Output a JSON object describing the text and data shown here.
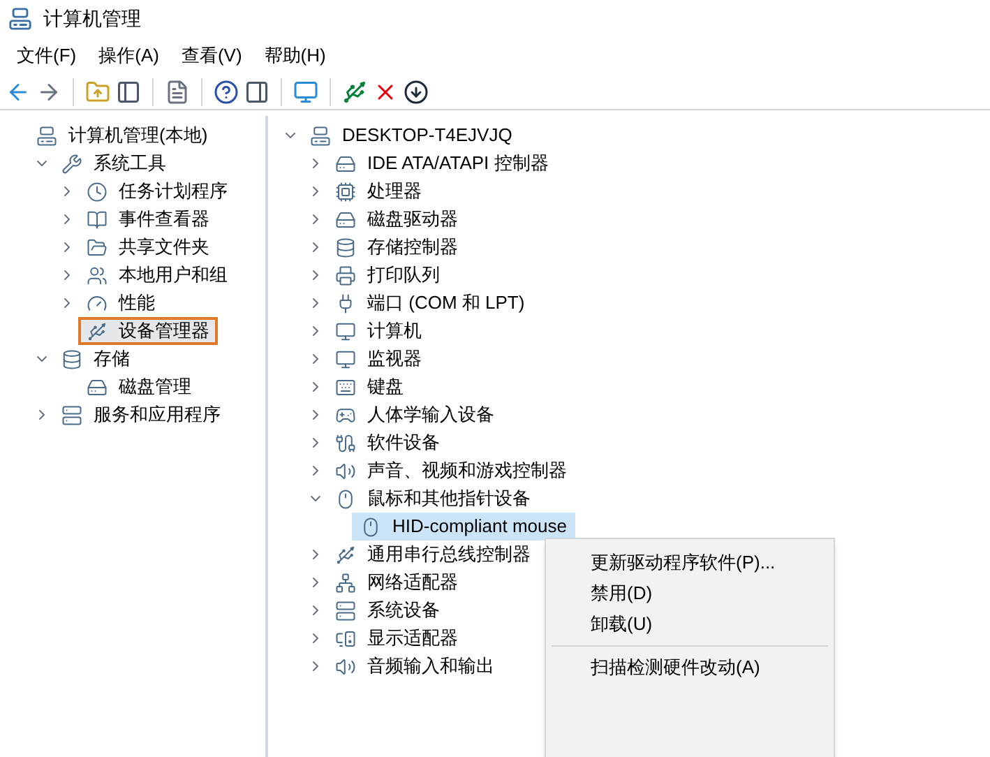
{
  "window": {
    "title": "计算机管理"
  },
  "menu": [
    "文件(F)",
    "操作(A)",
    "查看(V)",
    "帮助(H)"
  ],
  "left_tree": [
    {
      "label": "计算机管理(本地)",
      "selected": false,
      "children": [
        {
          "label": "系统工具",
          "expanded": true,
          "selected": false,
          "children": [
            {
              "label": "任务计划程序",
              "expanded": false,
              "selected": false
            },
            {
              "label": "事件查看器",
              "expanded": false,
              "selected": false
            },
            {
              "label": "共享文件夹",
              "expanded": false,
              "selected": false
            },
            {
              "label": "本地用户和组",
              "expanded": false,
              "selected": false
            },
            {
              "label": "性能",
              "expanded": false,
              "selected": false
            },
            {
              "label": "设备管理器",
              "selected": true
            }
          ]
        },
        {
          "label": "存储",
          "expanded": true,
          "selected": false,
          "children": [
            {
              "label": "磁盘管理",
              "selected": false
            }
          ]
        },
        {
          "label": "服务和应用程序",
          "expanded": false,
          "selected": false
        }
      ]
    }
  ],
  "device_tree": [
    {
      "label": "DESKTOP-T4EJVJQ",
      "expanded": true,
      "selected": false,
      "children": [
        {
          "label": "IDE ATA/ATAPI 控制器",
          "expanded": false,
          "selected": false
        },
        {
          "label": "处理器",
          "expanded": false,
          "selected": false
        },
        {
          "label": "磁盘驱动器",
          "expanded": false,
          "selected": false
        },
        {
          "label": "存储控制器",
          "expanded": false,
          "selected": false
        },
        {
          "label": "打印队列",
          "expanded": false,
          "selected": false
        },
        {
          "label": "端口 (COM 和 LPT)",
          "expanded": false,
          "selected": false
        },
        {
          "label": "计算机",
          "expanded": false,
          "selected": false
        },
        {
          "label": "监视器",
          "expanded": false,
          "selected": false
        },
        {
          "label": "键盘",
          "expanded": false,
          "selected": false
        },
        {
          "label": "人体学输入设备",
          "expanded": false,
          "selected": false
        },
        {
          "label": "软件设备",
          "expanded": false,
          "selected": false
        },
        {
          "label": "声音、视频和游戏控制器",
          "expanded": false,
          "selected": false
        },
        {
          "label": "鼠标和其他指针设备",
          "expanded": true,
          "selected": false,
          "children": [
            {
              "label": "HID-compliant mouse",
              "selected": true
            }
          ]
        },
        {
          "label": "通用串行总线控制器",
          "expanded": false,
          "selected": false
        },
        {
          "label": "网络适配器",
          "expanded": false,
          "selected": false
        },
        {
          "label": "系统设备",
          "expanded": false,
          "selected": false
        },
        {
          "label": "显示适配器",
          "expanded": false,
          "selected": false
        },
        {
          "label": "音频输入和输出",
          "expanded": false,
          "selected": false
        }
      ]
    }
  ],
  "context_menu": [
    {
      "label": "更新驱动程序软件(P)...",
      "kind": "item"
    },
    {
      "label": "禁用(D)",
      "kind": "item"
    },
    {
      "label": "卸载(U)",
      "kind": "item"
    },
    {
      "kind": "separator"
    },
    {
      "label": "扫描检测硬件改动(A)",
      "kind": "item"
    }
  ]
}
